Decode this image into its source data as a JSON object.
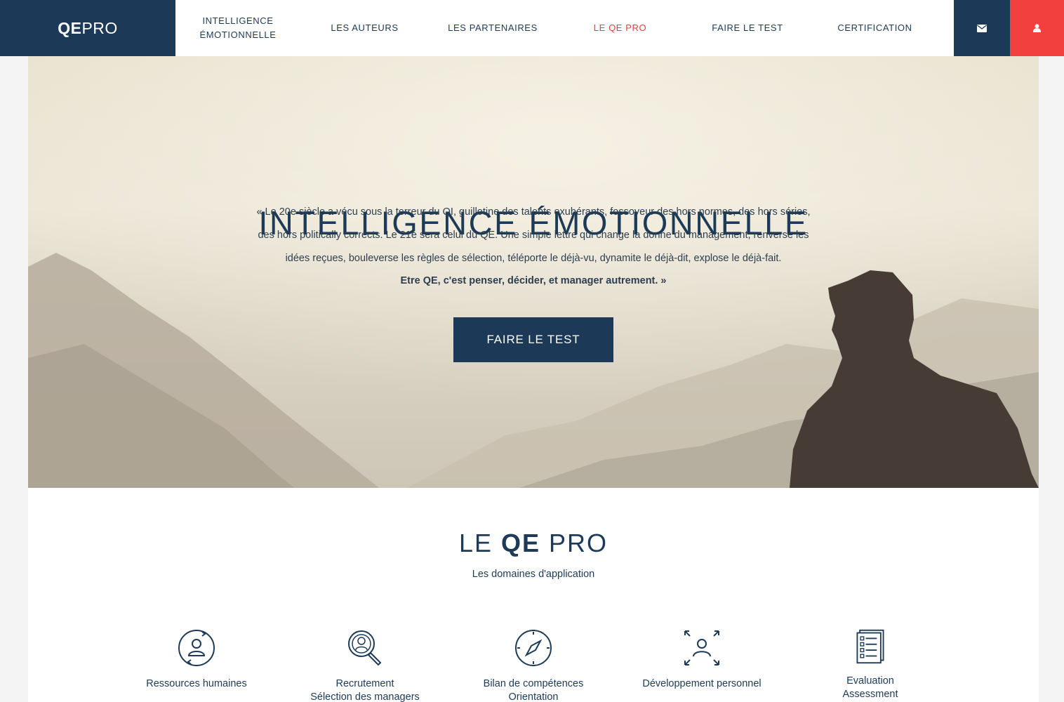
{
  "logo": {
    "bold": "QE",
    "light": "PRO"
  },
  "nav": {
    "items": [
      {
        "line1": "INTELLIGENCE",
        "line2": "ÉMOTIONNELLE"
      },
      {
        "label": "LES AUTEURS"
      },
      {
        "label": "LES PARTENAIRES"
      },
      {
        "label": "LE QE PRO"
      },
      {
        "label": "FAIRE LE TEST"
      },
      {
        "label": "CERTIFICATION"
      }
    ],
    "active_index": 3,
    "mail_icon": "envelope-icon",
    "user_icon": "user-icon"
  },
  "hero": {
    "title": "INTELLIGENCE ÉMOTIONNELLE",
    "quote_lines": [
      "« Le 20e siècle a vécu sous la terreur du QI, guillotine des talents exubérants, fossoyeur des hors normes, des hors séries,",
      "des hors politically corrects. Le 21e sera celui du QE. Une simple lettre qui change la donne du management, renverse les",
      "idées reçues, bouleverse les règles de sélection, téléporte le déjà-vu, dynamite le déjà-dit, explose le déjà-fait."
    ],
    "quote_bold": "Etre QE, c'est penser, décider, et manager autrement. »",
    "cta": "FAIRE LE TEST"
  },
  "section": {
    "title_pre": "LE ",
    "title_bold": "QE",
    "title_post": " PRO",
    "subtitle": "Les domaines d'application",
    "domains": [
      {
        "icon": "user-cycle-icon",
        "line1": "Ressources humaines",
        "line2": ""
      },
      {
        "icon": "magnifier-person-icon",
        "line1": "Recrutement",
        "line2": "Sélection des managers"
      },
      {
        "icon": "compass-icon",
        "line1": "Bilan de compétences",
        "line2": "Orientation"
      },
      {
        "icon": "person-expand-icon",
        "line1": "Développement personnel",
        "line2": ""
      },
      {
        "icon": "checklist-icon",
        "line1": "Evaluation",
        "line2": "Assessment"
      }
    ]
  },
  "colors": {
    "navy": "#1c3a57",
    "red": "#f2403f",
    "active": "#e8413c"
  }
}
